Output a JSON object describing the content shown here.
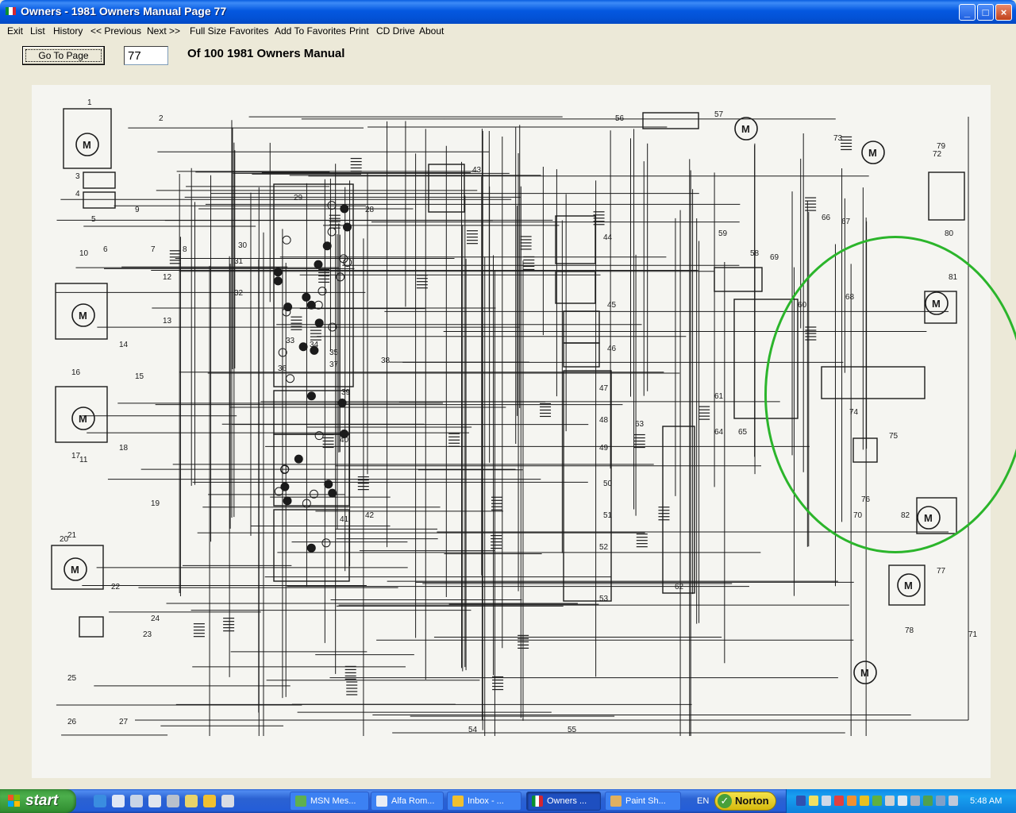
{
  "window": {
    "title": "Owners - 1981 Owners Manual Page 77",
    "controls": {
      "minimize": "_",
      "maximize": "□",
      "close": "×"
    }
  },
  "menu": [
    "Exit",
    "List",
    "History",
    "<< Previous",
    "Next >>",
    "Full Size",
    "Favorites",
    "Add To Favorites",
    "Print",
    "CD Drive",
    "About"
  ],
  "toolbar": {
    "goto_label": "Go To Page",
    "page_value": "77",
    "of_label": "Of 100 1981 Owners Manual"
  },
  "diagram": {
    "labels": [
      "1",
      "2",
      "3",
      "4",
      "5",
      "6",
      "7",
      "8",
      "9",
      "10",
      "11",
      "12",
      "13",
      "14",
      "15",
      "16",
      "17",
      "18",
      "19",
      "20",
      "21",
      "22",
      "23",
      "24",
      "25",
      "26",
      "27",
      "28",
      "29",
      "30",
      "31",
      "32",
      "33",
      "34",
      "35",
      "36",
      "37",
      "38",
      "39",
      "40",
      "41",
      "42",
      "43",
      "44",
      "45",
      "46",
      "47",
      "48",
      "49",
      "50",
      "51",
      "52",
      "53",
      "54",
      "55",
      "56",
      "57",
      "58",
      "59",
      "60",
      "61",
      "62",
      "63",
      "64",
      "65",
      "66",
      "67",
      "68",
      "69",
      "70",
      "71",
      "72",
      "73",
      "74",
      "75",
      "76",
      "77",
      "78",
      "79",
      "80",
      "81",
      "82"
    ],
    "highlight_color": "#2bb52b"
  },
  "taskbar": {
    "start_label": "start",
    "tasks": [
      {
        "label": "MSN Mes...",
        "active": false
      },
      {
        "label": "Alfa Rom...",
        "active": false
      },
      {
        "label": "Inbox - ...",
        "active": false
      },
      {
        "label": "Owners ...",
        "active": true
      },
      {
        "label": "Paint Sh...",
        "active": false
      }
    ],
    "language": "EN",
    "norton_label": "Norton",
    "clock": "5:48 AM"
  }
}
